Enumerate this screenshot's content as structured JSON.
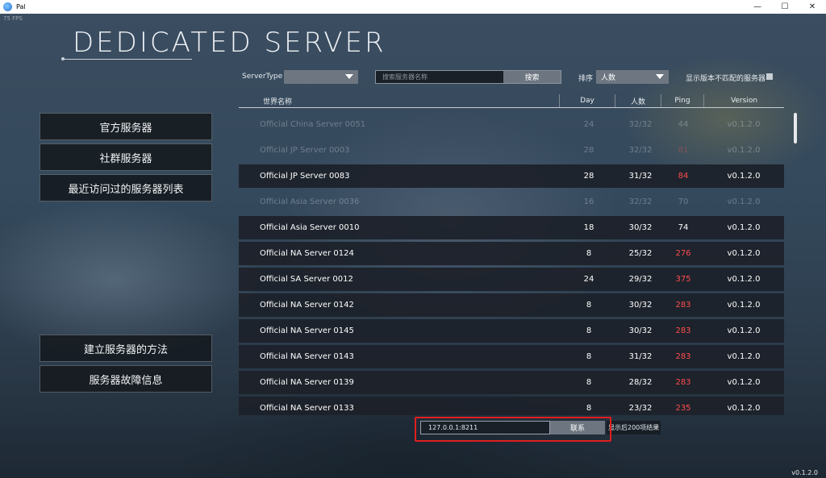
{
  "window": {
    "title": "Pal",
    "minimize": "—",
    "maximize": "☐",
    "close": "✕"
  },
  "fps": "75 FPS",
  "page_title": "DEDICATED SERVER",
  "menu": {
    "official": "官方服务器",
    "community": "社群服务器",
    "recent": "最近访问过的服务器列表",
    "how_to": "建立服务器的方法",
    "troubleshoot": "服务器故障信息"
  },
  "filters": {
    "server_type_label": "ServerType",
    "server_type_value": "",
    "search_placeholder": "搜索服务器名称",
    "search_button": "搜索",
    "sort_label": "排序",
    "sort_value": "人数",
    "mismatch_label": "显示版本不匹配的服务器"
  },
  "table": {
    "headers": {
      "name": "世界名称",
      "day": "Day",
      "players": "人数",
      "ping": "Ping",
      "version": "Version"
    },
    "rows": [
      {
        "name": "Official China Server 0051",
        "day": "24",
        "players": "32/32",
        "ping": "44",
        "version": "v0.1.2.0",
        "dim": true,
        "high_ping": false
      },
      {
        "name": "Official JP Server 0003",
        "day": "28",
        "players": "32/32",
        "ping": "81",
        "version": "v0.1.2.0",
        "dim": true,
        "high_ping": true
      },
      {
        "name": "Official JP Server 0083",
        "day": "28",
        "players": "31/32",
        "ping": "84",
        "version": "v0.1.2.0",
        "dim": false,
        "high_ping": true
      },
      {
        "name": "Official Asia Server 0036",
        "day": "16",
        "players": "32/32",
        "ping": "70",
        "version": "v0.1.2.0",
        "dim": true,
        "high_ping": false
      },
      {
        "name": "Official Asia Server 0010",
        "day": "18",
        "players": "30/32",
        "ping": "74",
        "version": "v0.1.2.0",
        "dim": false,
        "high_ping": false
      },
      {
        "name": "Official NA Server 0124",
        "day": "8",
        "players": "25/32",
        "ping": "276",
        "version": "v0.1.2.0",
        "dim": false,
        "high_ping": true
      },
      {
        "name": "Official SA Server 0012",
        "day": "24",
        "players": "29/32",
        "ping": "375",
        "version": "v0.1.2.0",
        "dim": false,
        "high_ping": true
      },
      {
        "name": "Official NA Server 0142",
        "day": "8",
        "players": "30/32",
        "ping": "283",
        "version": "v0.1.2.0",
        "dim": false,
        "high_ping": true
      },
      {
        "name": "Official NA Server 0145",
        "day": "8",
        "players": "30/32",
        "ping": "283",
        "version": "v0.1.2.0",
        "dim": false,
        "high_ping": true
      },
      {
        "name": "Official NA Server 0143",
        "day": "8",
        "players": "31/32",
        "ping": "283",
        "version": "v0.1.2.0",
        "dim": false,
        "high_ping": true
      },
      {
        "name": "Official NA Server 0139",
        "day": "8",
        "players": "28/32",
        "ping": "283",
        "version": "v0.1.2.0",
        "dim": false,
        "high_ping": true
      },
      {
        "name": "Official NA Server 0133",
        "day": "8",
        "players": "23/32",
        "ping": "235",
        "version": "v0.1.2.0",
        "dim": false,
        "high_ping": true
      }
    ]
  },
  "connect": {
    "address": "127.0.0.1:8211",
    "button": "联系",
    "results_note": "显示后200项结果"
  },
  "version_footer": "v0.1.2.0"
}
